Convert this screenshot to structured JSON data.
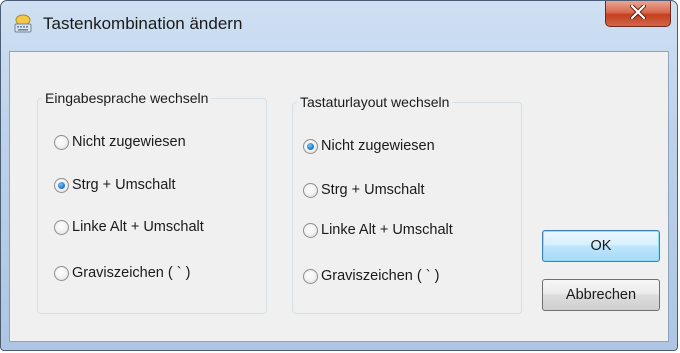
{
  "window": {
    "title": "Tastenkombination ändern",
    "icon": "keyboard-icon",
    "close_icon": "close-icon"
  },
  "group_input_language": {
    "legend": "Eingabesprache wechseln",
    "options": [
      {
        "label": "Nicht zugewiesen",
        "checked": false
      },
      {
        "label": "Strg + Umschalt",
        "checked": true
      },
      {
        "label": "Linke Alt + Umschalt",
        "checked": false
      },
      {
        "label": "Graviszeichen ( ` )",
        "checked": false
      }
    ]
  },
  "group_keyboard_layout": {
    "legend": "Tastaturlayout wechseln",
    "options": [
      {
        "label": "Nicht zugewiesen",
        "checked": true
      },
      {
        "label": "Strg + Umschalt",
        "checked": false
      },
      {
        "label": "Linke Alt + Umschalt",
        "checked": false
      },
      {
        "label": "Graviszeichen ( ` )",
        "checked": false
      }
    ]
  },
  "buttons": {
    "ok": "OK",
    "cancel": "Abbrechen"
  },
  "colors": {
    "titlebar": "#bcd1ea",
    "close_button": "#c5401f",
    "radio_selected": "#2a7fd0",
    "default_button_border": "#3c7fb1"
  }
}
